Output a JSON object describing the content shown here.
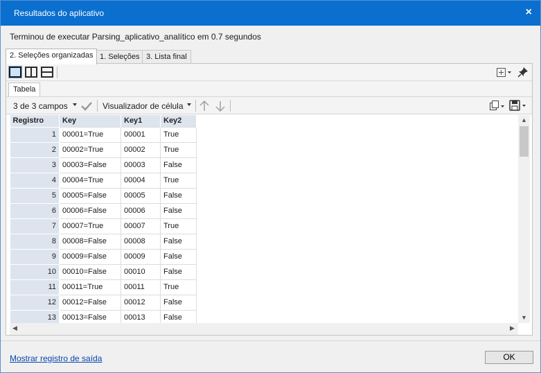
{
  "window": {
    "title": "Resultados do aplicativo",
    "close_glyph": "×"
  },
  "message": "Terminou de executar Parsing_aplicativo_analítico em 0.7 segundos",
  "tabs": [
    {
      "label": "2. Seleções organizadas",
      "active": true
    },
    {
      "label": "1. Seleções",
      "active": false
    },
    {
      "label": "3. Lista final",
      "active": false
    }
  ],
  "subtab": {
    "label": "Tabela"
  },
  "toolbar": {
    "fields_label": "3 de 3 campos",
    "cell_viewer_label": "Visualizador de célula"
  },
  "table": {
    "columns": [
      "Registro",
      "Key",
      "Key1",
      "Key2"
    ],
    "rows": [
      [
        "1",
        "00001=True",
        "00001",
        "True"
      ],
      [
        "2",
        "00002=True",
        "00002",
        "True"
      ],
      [
        "3",
        "00003=False",
        "00003",
        "False"
      ],
      [
        "4",
        "00004=True",
        "00004",
        "True"
      ],
      [
        "5",
        "00005=False",
        "00005",
        "False"
      ],
      [
        "6",
        "00006=False",
        "00006",
        "False"
      ],
      [
        "7",
        "00007=True",
        "00007",
        "True"
      ],
      [
        "8",
        "00008=False",
        "00008",
        "False"
      ],
      [
        "9",
        "00009=False",
        "00009",
        "False"
      ],
      [
        "10",
        "00010=False",
        "00010",
        "False"
      ],
      [
        "11",
        "00011=True",
        "00011",
        "True"
      ],
      [
        "12",
        "00012=False",
        "00012",
        "False"
      ],
      [
        "13",
        "00013=False",
        "00013",
        "False"
      ]
    ]
  },
  "footer": {
    "log_link": "Mostrar registro de saída",
    "ok_label": "OK"
  },
  "colors": {
    "titlebar": "#0a6fcf",
    "header_bg": "#dde4ee",
    "link": "#0645ad"
  },
  "icons": [
    "single-pane-icon",
    "split-vertical-icon",
    "split-horizontal-icon",
    "add-column-icon",
    "pin-icon",
    "check-icon",
    "up-arrow-icon",
    "down-arrow-icon",
    "copy-icon",
    "save-icon"
  ]
}
